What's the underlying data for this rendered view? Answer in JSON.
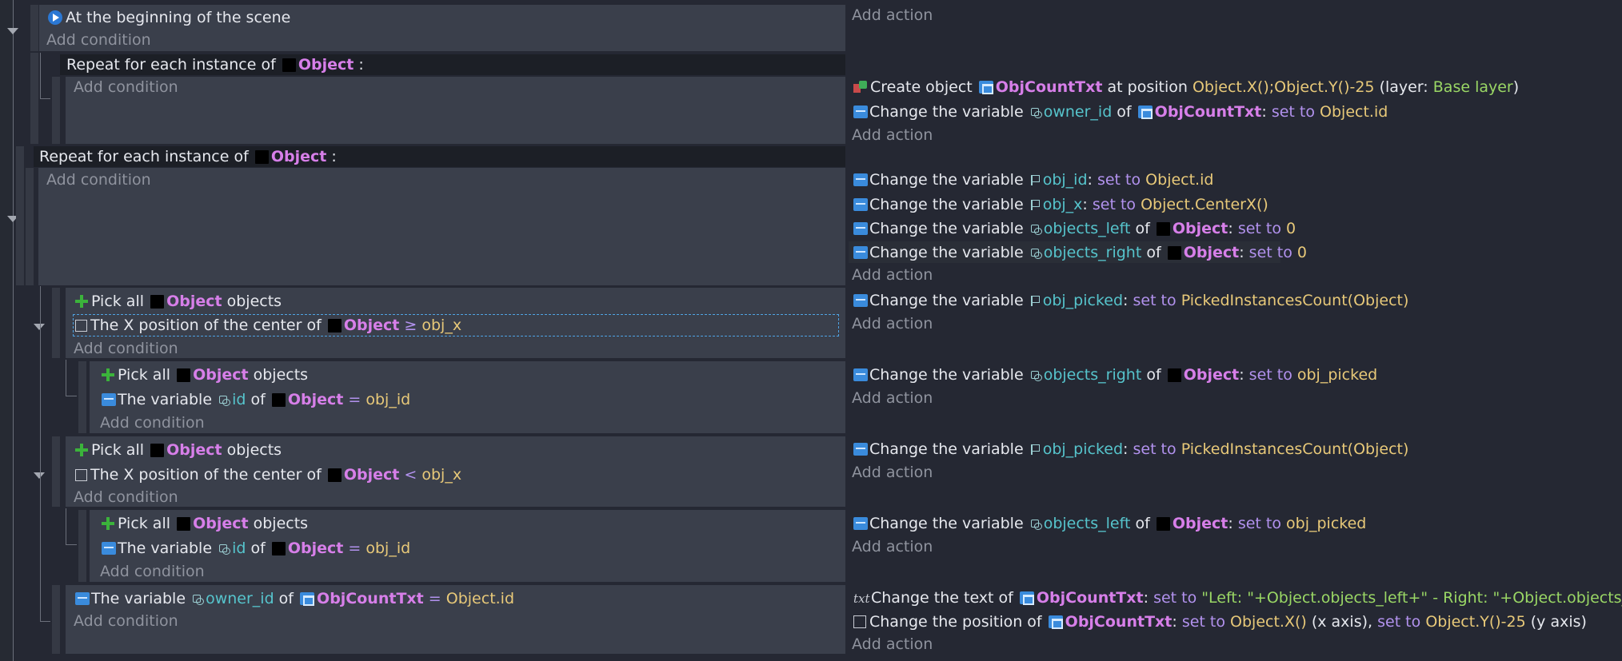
{
  "ev1": {
    "cond": "At the beginning of the scene",
    "add_condition": "Add condition",
    "add_action": "Add action"
  },
  "ev2": {
    "repeat_prefix": "Repeat for each instance of",
    "repeat_obj": "Object",
    "colon": ":",
    "add_condition": "Add condition",
    "a1": {
      "pre": "Create object",
      "obj": "ObjCountTxt",
      "mid": "at position",
      "val": "Object.X();Object.Y()-25",
      "layer_pre": "(layer:",
      "layer": "Base layer",
      "layer_post": ")"
    },
    "a2": {
      "pre": "Change the variable",
      "var": "owner_id",
      "of": "of",
      "obj": "ObjCountTxt",
      "colon": ":",
      "op": "set to",
      "val": "Object.id"
    },
    "add_action": "Add action"
  },
  "ev3": {
    "repeat_prefix": "Repeat for each instance of",
    "repeat_obj": "Object",
    "colon": ":",
    "add_condition": "Add condition",
    "a1": {
      "pre": "Change the variable",
      "var": "obj_id",
      "colon": ":",
      "op": "set to",
      "val": "Object.id"
    },
    "a2": {
      "pre": "Change the variable",
      "var": "obj_x",
      "colon": ":",
      "op": "set to",
      "val": "Object.CenterX()"
    },
    "a3": {
      "pre": "Change the variable",
      "var": "objects_left",
      "of": "of",
      "obj": "Object",
      "colon": ":",
      "op": "set to",
      "val": "0"
    },
    "a4": {
      "pre": "Change the variable",
      "var": "objects_right",
      "of": "of",
      "obj": "Object",
      "colon": ":",
      "op": "set to",
      "val": "0"
    },
    "add_action": "Add action"
  },
  "ev4": {
    "c1": {
      "pre": "Pick all",
      "obj": "Object",
      "post": "objects"
    },
    "c2": {
      "pre": "The X position of the center of",
      "obj": "Object",
      "op": "≥",
      "val": "obj_x"
    },
    "add_condition": "Add condition",
    "a1": {
      "pre": "Change the variable",
      "var": "obj_picked",
      "colon": ":",
      "op": "set to",
      "val": "PickedInstancesCount(Object)"
    },
    "add_action": "Add action"
  },
  "ev5": {
    "c1": {
      "pre": "Pick all",
      "obj": "Object",
      "post": "objects"
    },
    "c2": {
      "pre": "The variable",
      "var": "id",
      "of": "of",
      "obj": "Object",
      "op": "=",
      "val": "obj_id"
    },
    "add_condition": "Add condition",
    "a1": {
      "pre": "Change the variable",
      "var": "objects_right",
      "of": "of",
      "obj": "Object",
      "colon": ":",
      "op": "set to",
      "val": "obj_picked"
    },
    "add_action": "Add action"
  },
  "ev6": {
    "c1": {
      "pre": "Pick all",
      "obj": "Object",
      "post": "objects"
    },
    "c2": {
      "pre": "The X position of the center of",
      "obj": "Object",
      "op": "<",
      "val": "obj_x"
    },
    "add_condition": "Add condition",
    "a1": {
      "pre": "Change the variable",
      "var": "obj_picked",
      "colon": ":",
      "op": "set to",
      "val": "PickedInstancesCount(Object)"
    },
    "add_action": "Add action"
  },
  "ev7": {
    "c1": {
      "pre": "Pick all",
      "obj": "Object",
      "post": "objects"
    },
    "c2": {
      "pre": "The variable",
      "var": "id",
      "of": "of",
      "obj": "Object",
      "op": "=",
      "val": "obj_id"
    },
    "add_condition": "Add condition",
    "a1": {
      "pre": "Change the variable",
      "var": "objects_left",
      "of": "of",
      "obj": "Object",
      "colon": ":",
      "op": "set to",
      "val": "obj_picked"
    },
    "add_action": "Add action"
  },
  "ev8": {
    "c1": {
      "pre": "The variable",
      "var": "owner_id",
      "of": "of",
      "obj": "ObjCountTxt",
      "op": "=",
      "val": "Object.id"
    },
    "add_condition": "Add condition",
    "a1": {
      "pre": "Change the text of",
      "obj": "ObjCountTxt",
      "colon": ":",
      "op": "set to",
      "val": "\"Left: \"+Object.objects_left+\" - Right: \"+Object.objects_right"
    },
    "a2": {
      "pre": "Change the position of",
      "obj": "ObjCountTxt",
      "colon": ":",
      "op1": "set to",
      "val1": "Object.X()",
      "axis1": "(x axis),",
      "op2": "set to",
      "val2": "Object.Y()-25",
      "axis2": "(y axis)"
    },
    "add_action": "Add action"
  }
}
